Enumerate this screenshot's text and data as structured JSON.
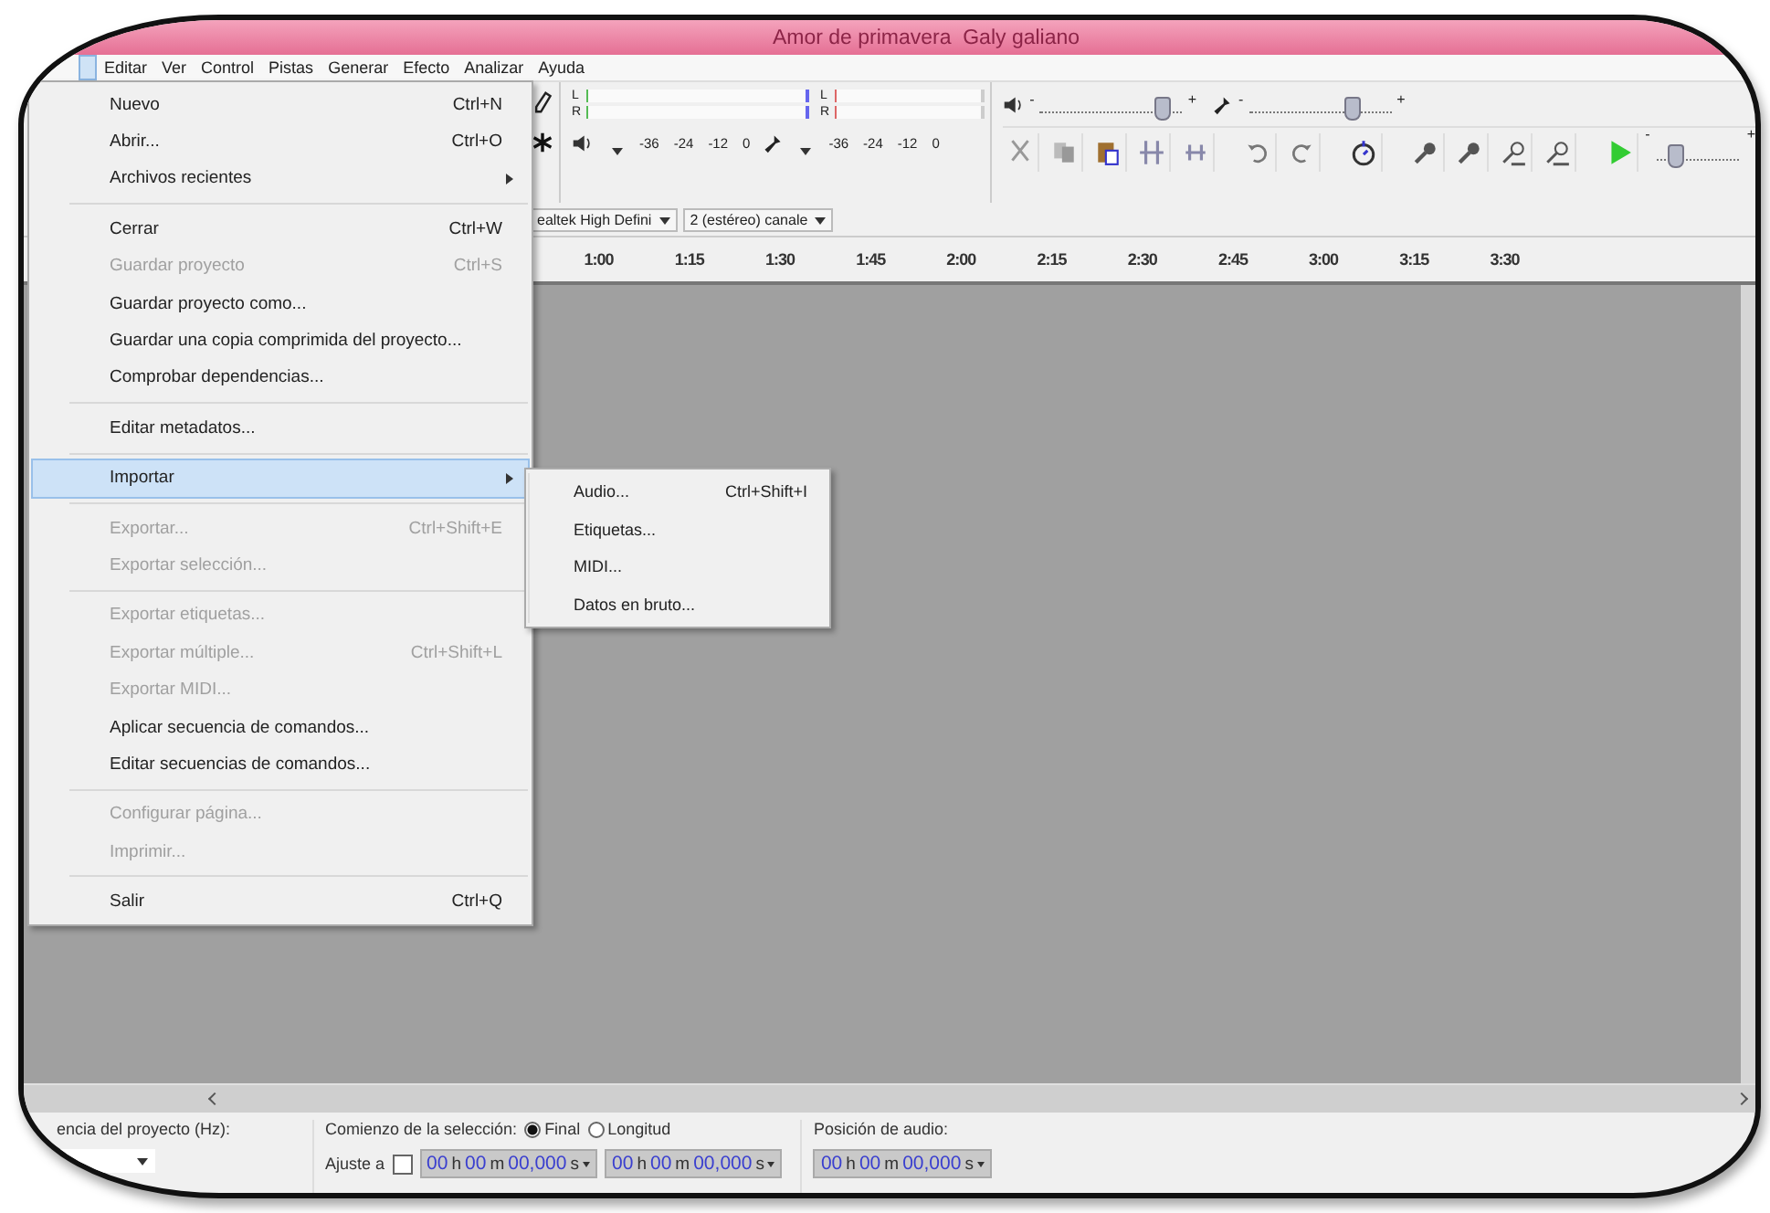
{
  "window": {
    "title": "Amor de primavera  Galy galiano"
  },
  "menu_bar": [
    {
      "label": "Editar"
    },
    {
      "label": "Ver"
    },
    {
      "label": "Control"
    },
    {
      "label": "Pistas"
    },
    {
      "label": "Generar"
    },
    {
      "label": "Efecto"
    },
    {
      "label": "Analizar"
    },
    {
      "label": "Ayuda"
    }
  ],
  "meters": [
    {
      "kind": "playback",
      "channels": [
        "L",
        "R"
      ],
      "scale": [
        "-36",
        "-24",
        "-12",
        "0"
      ]
    },
    {
      "kind": "recording",
      "channels": [
        "L",
        "R"
      ],
      "scale": [
        "-36",
        "-24",
        "-12",
        "0"
      ]
    }
  ],
  "mixer": [
    {
      "kind": "playback",
      "level": 0.85,
      "min": "-",
      "max": "+"
    },
    {
      "kind": "recording",
      "level": 0.72,
      "min": "-",
      "max": "+"
    }
  ],
  "play_at_speed": {
    "level": 0.22,
    "min": "-",
    "max": "+"
  },
  "devices": [
    "ealtek High Defini",
    "2 (estéreo) canale"
  ],
  "ruler": {
    "ticks": [
      "1:00",
      "1:15",
      "1:30",
      "1:45",
      "2:00",
      "2:15",
      "2:30",
      "2:45",
      "3:00",
      "3:15",
      "3:30"
    ]
  },
  "file_menu": {
    "items": [
      {
        "kind": "item",
        "label": "Nuevo",
        "shortcut": "Ctrl+N",
        "disabled": false,
        "selected": false,
        "submenu": false
      },
      {
        "kind": "item",
        "label": "Abrir...",
        "shortcut": "Ctrl+O",
        "disabled": false,
        "selected": false,
        "submenu": false
      },
      {
        "kind": "item",
        "label": "Archivos recientes",
        "disabled": false,
        "selected": false,
        "submenu": true
      },
      {
        "kind": "separator"
      },
      {
        "kind": "item",
        "label": "Cerrar",
        "shortcut": "Ctrl+W",
        "disabled": false,
        "selected": false,
        "submenu": false
      },
      {
        "kind": "item",
        "label": "Guardar proyecto",
        "shortcut": "Ctrl+S",
        "disabled": true,
        "selected": false,
        "submenu": false
      },
      {
        "kind": "item",
        "label": "Guardar proyecto como...",
        "disabled": false,
        "selected": false,
        "submenu": false
      },
      {
        "kind": "item",
        "label": "Guardar una copia comprimida del proyecto...",
        "disabled": false,
        "selected": false,
        "submenu": false
      },
      {
        "kind": "item",
        "label": "Comprobar dependencias...",
        "disabled": false,
        "selected": false,
        "submenu": false
      },
      {
        "kind": "separator"
      },
      {
        "kind": "item",
        "label": "Editar metadatos...",
        "disabled": false,
        "selected": false,
        "submenu": false
      },
      {
        "kind": "separator"
      },
      {
        "kind": "item",
        "label": "Importar",
        "disabled": false,
        "selected": true,
        "submenu": true
      },
      {
        "kind": "separator"
      },
      {
        "kind": "item",
        "label": "Exportar...",
        "shortcut": "Ctrl+Shift+E",
        "disabled": true,
        "selected": false,
        "submenu": false
      },
      {
        "kind": "item",
        "label": "Exportar selección...",
        "disabled": true,
        "selected": false,
        "submenu": false
      },
      {
        "kind": "separator"
      },
      {
        "kind": "item",
        "label": "Exportar etiquetas...",
        "disabled": true,
        "selected": false,
        "submenu": false
      },
      {
        "kind": "item",
        "label": "Exportar múltiple...",
        "shortcut": "Ctrl+Shift+L",
        "disabled": true,
        "selected": false,
        "submenu": false
      },
      {
        "kind": "item",
        "label": "Exportar MIDI...",
        "disabled": true,
        "selected": false,
        "submenu": false
      },
      {
        "kind": "item",
        "label": "Aplicar secuencia de comandos...",
        "disabled": false,
        "selected": false,
        "submenu": false
      },
      {
        "kind": "item",
        "label": "Editar secuencias de comandos...",
        "disabled": false,
        "selected": false,
        "submenu": false
      },
      {
        "kind": "separator"
      },
      {
        "kind": "item",
        "label": "Configurar página...",
        "disabled": true,
        "selected": false,
        "submenu": false
      },
      {
        "kind": "item",
        "label": "Imprimir...",
        "disabled": true,
        "selected": false,
        "submenu": false
      },
      {
        "kind": "separator"
      },
      {
        "kind": "item",
        "label": "Salir",
        "shortcut": "Ctrl+Q",
        "disabled": false,
        "selected": false,
        "submenu": false
      }
    ]
  },
  "import_submenu": {
    "items": [
      {
        "label": "Audio...",
        "shortcut": "Ctrl+Shift+I"
      },
      {
        "label": "Etiquetas..."
      },
      {
        "label": "MIDI..."
      },
      {
        "label": "Datos en bruto..."
      }
    ]
  },
  "status_bar": {
    "rate_label": "encia del proyecto (Hz):",
    "selection_label": "Comienzo de la selección:",
    "snap": {
      "label": "Ajuste a",
      "checked": false
    },
    "modes": [
      {
        "label": "Final",
        "selected": true
      },
      {
        "label": "Longitud",
        "selected": false
      }
    ],
    "selection_times": [
      "00 h 00 m 00,000 s",
      "00 h 00 m 00,000 s"
    ],
    "audio_position_label": "Posición de audio:",
    "audio_position": "00 h 00 m 00,000 s"
  }
}
